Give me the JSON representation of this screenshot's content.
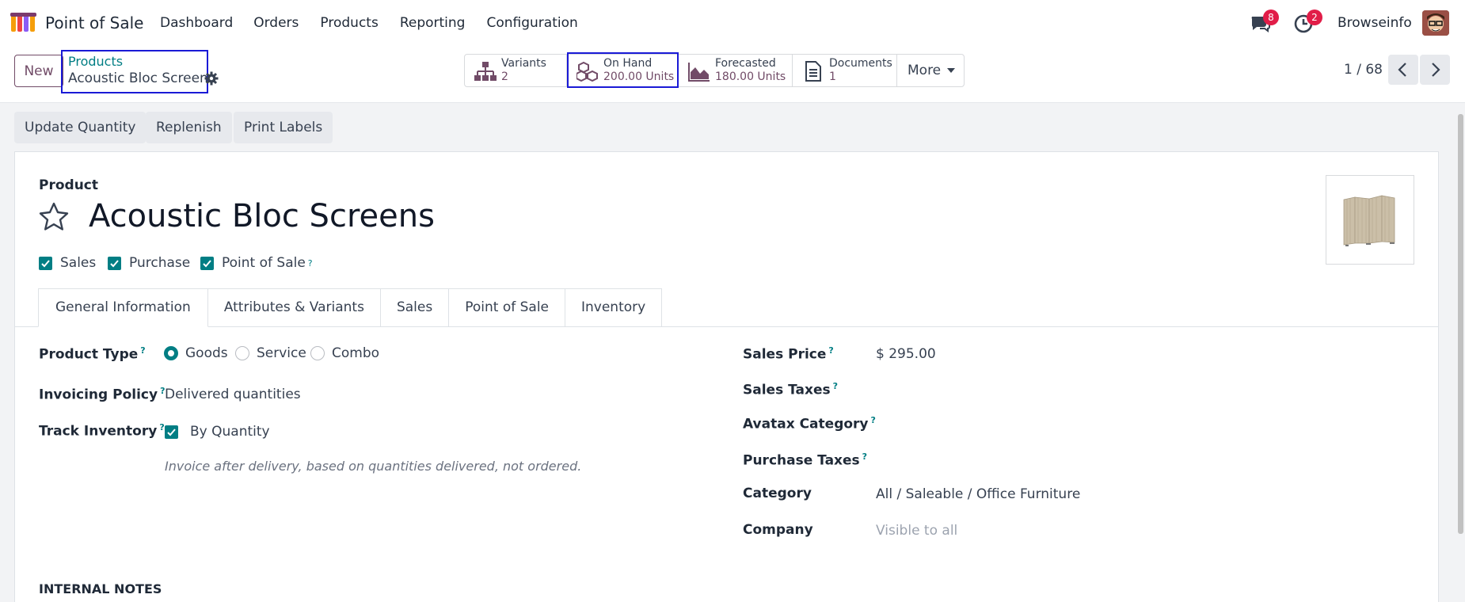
{
  "app": {
    "name": "Point of Sale",
    "menu": [
      "Dashboard",
      "Orders",
      "Products",
      "Reporting",
      "Configuration"
    ],
    "messages_badge": "8",
    "activities_badge": "2",
    "user_name": "Browseinfo"
  },
  "control": {
    "new_label": "New",
    "breadcrumb_parent": "Products",
    "breadcrumb_current": "Acoustic Bloc Screens",
    "stats": [
      {
        "label": "Variants",
        "value": "2",
        "icon": "hierarchy-icon"
      },
      {
        "label": "On Hand",
        "value": "200.00 Units",
        "icon": "cubes-icon"
      },
      {
        "label": "Forecasted",
        "value": "180.00 Units",
        "icon": "area-chart-icon"
      },
      {
        "label": "Documents",
        "value": "1",
        "icon": "document-icon"
      }
    ],
    "more_label": "More",
    "pager": "1 / 68"
  },
  "actions": [
    "Update Quantity",
    "Replenish",
    "Print Labels"
  ],
  "product": {
    "section_label": "Product",
    "title": "Acoustic Bloc Screens",
    "flags": [
      {
        "label": "Sales",
        "checked": true
      },
      {
        "label": "Purchase",
        "checked": true
      },
      {
        "label": "Point of Sale",
        "checked": true,
        "help": "?"
      }
    ]
  },
  "tabs": [
    "General Information",
    "Attributes & Variants",
    "Sales",
    "Point of Sale",
    "Inventory"
  ],
  "general": {
    "product_type_label": "Product Type",
    "product_type_options": [
      "Goods",
      "Service",
      "Combo"
    ],
    "product_type_selected": "Goods",
    "invoicing_policy_label": "Invoicing Policy",
    "invoicing_policy_value": "Delivered quantities",
    "track_inventory_label": "Track Inventory",
    "track_inventory_value": "By Quantity",
    "invoice_note": "Invoice after delivery, based on quantities delivered, not ordered.",
    "sales_price_label": "Sales Price",
    "sales_price_value": "$ 295.00",
    "sales_taxes_label": "Sales Taxes",
    "avatax_label": "Avatax Category",
    "purchase_taxes_label": "Purchase Taxes",
    "category_label": "Category",
    "category_value": "All / Saleable / Office Furniture",
    "company_label": "Company",
    "company_value": "Visible to all",
    "internal_notes_label": "INTERNAL NOTES",
    "help_mark": "?"
  },
  "colors": {
    "brand": "#714b67",
    "accent": "#017e84",
    "badge": "#e11d48",
    "highlight": "#1a1ad6"
  }
}
